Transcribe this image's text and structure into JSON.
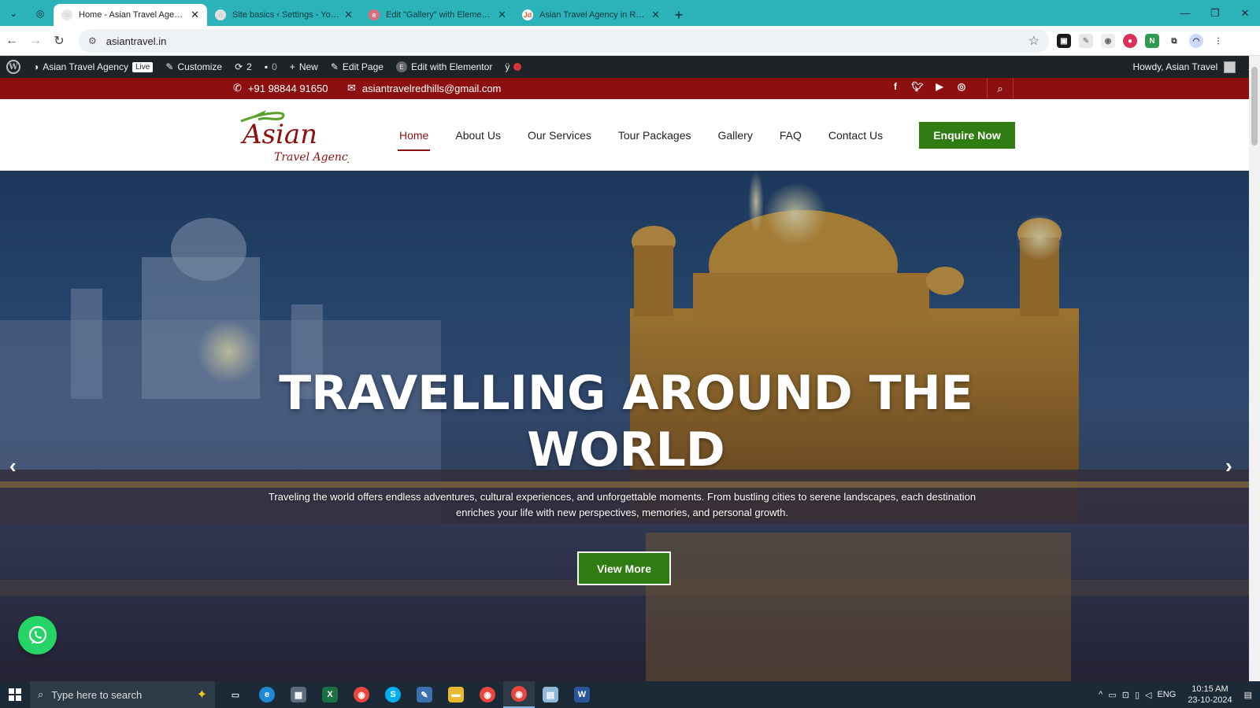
{
  "browser": {
    "tabs": [
      {
        "title": "Home - Asian Travel Agency",
        "active": true,
        "favicon_color": "#9aa0a6"
      },
      {
        "title": "Site basics ‹ Settings - Yoast SEO",
        "active": false,
        "favicon_color": "#d9d9d9"
      },
      {
        "title": "Edit \"Gallery\" with Elementor",
        "active": false,
        "favicon_color": "#e06b7a"
      },
      {
        "title": "Asian Travel Agency in Redhills",
        "active": false,
        "favicon_color": "#e05a2b"
      }
    ],
    "address": "asiantravel.in"
  },
  "wp_admin_bar": {
    "site_name": "Asian Travel Agency",
    "live_badge": "Live",
    "customize": "Customize",
    "updates_count": "2",
    "comments_count": "0",
    "new_label": "New",
    "edit_page": "Edit Page",
    "edit_elementor": "Edit with Elementor",
    "howdy": "Howdy, Asian Travel"
  },
  "topbar": {
    "phone": "+91 98844 91650",
    "email": "asiantravelredhills@gmail.com",
    "social_icons": [
      "facebook-icon",
      "twitter-icon",
      "youtube-icon",
      "instagram-icon"
    ]
  },
  "header": {
    "logo_text_main": "Asian",
    "logo_text_sub": "Travel Agency",
    "nav": [
      {
        "label": "Home",
        "current": true
      },
      {
        "label": "About Us",
        "current": false
      },
      {
        "label": "Our Services",
        "current": false
      },
      {
        "label": "Tour Packages",
        "current": false
      },
      {
        "label": "Gallery",
        "current": false
      },
      {
        "label": "FAQ",
        "current": false
      },
      {
        "label": "Contact Us",
        "current": false
      }
    ],
    "cta": "Enquire Now"
  },
  "hero": {
    "headline": "TRAVELLING AROUND THE WORLD",
    "description": "Traveling the world offers endless adventures, cultural experiences, and unforgettable moments. From bustling cities to serene landscapes, each destination enriches your life with new perspectives, memories, and personal growth.",
    "button": "View More"
  },
  "taskbar": {
    "search_placeholder": "Type here to search",
    "language": "ENG",
    "time": "10:15 AM",
    "date": "23-10-2024"
  },
  "colors": {
    "brand_red": "#8d1010",
    "brand_green": "#2f7d12",
    "tab_strip": "#2bb3b9",
    "wp_bar": "#1d2327"
  }
}
